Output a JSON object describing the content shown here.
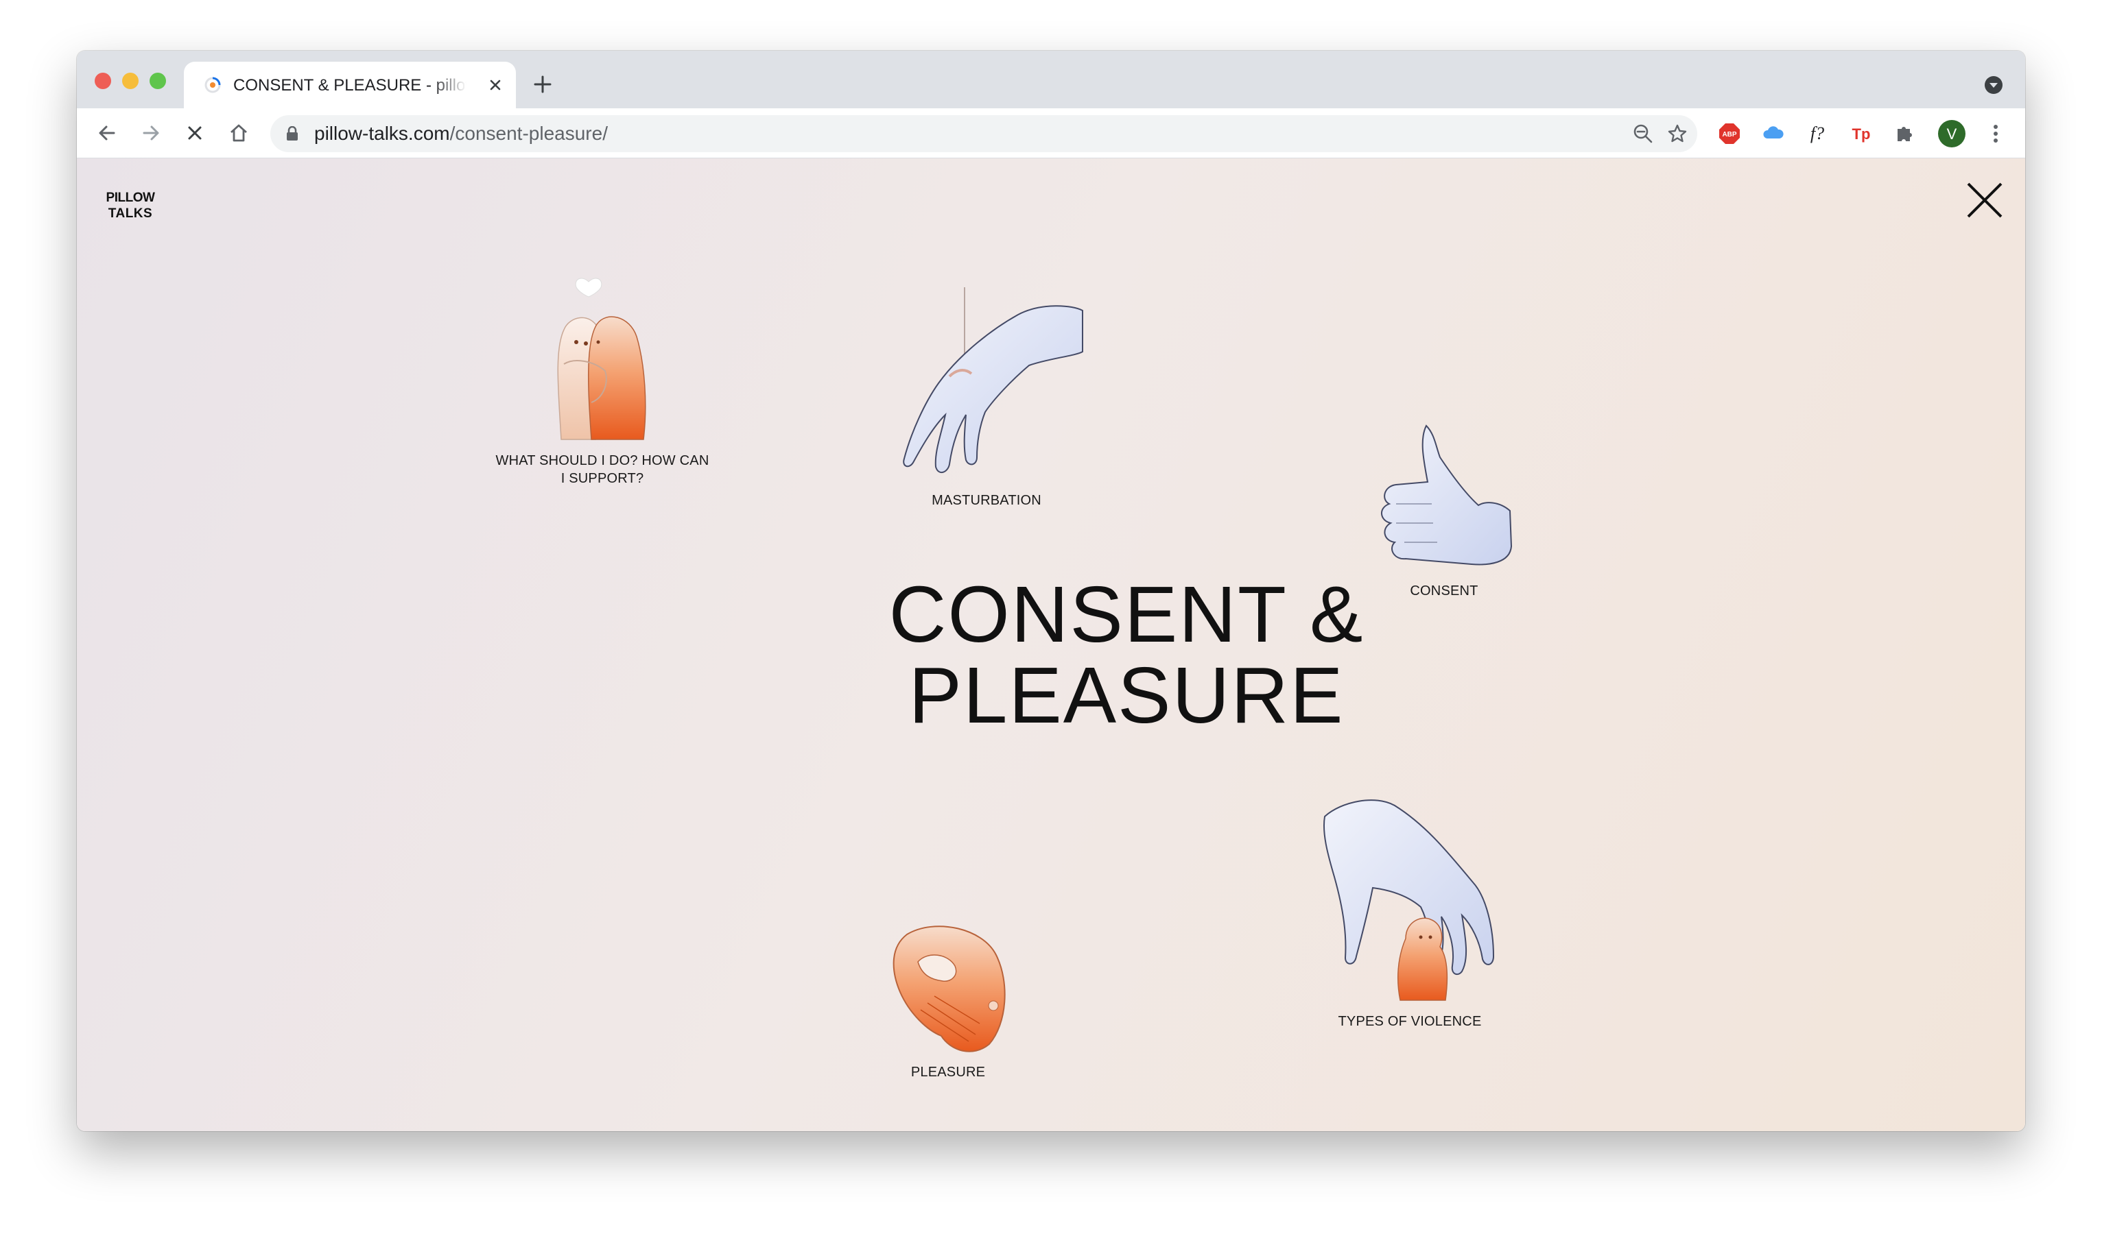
{
  "browser": {
    "tab_title": "CONSENT & PLEASURE - pillow-talks",
    "url_host": "pillow-talks.com",
    "url_path": "/consent-pleasure/",
    "profile_initial": "V",
    "ext_abp": "ABP",
    "ext_font": "f?",
    "ext_tp": "Tp"
  },
  "site": {
    "logo_line1": "PILLOW",
    "logo_line2": "TALKS",
    "heading_line1": "CONSENT &",
    "heading_line2": "PLEASURE"
  },
  "topics": [
    {
      "label": "WHAT SHOULD I DO? HOW CAN I SUPPORT?",
      "icon": "hugging-figures-icon"
    },
    {
      "label": "MASTURBATION",
      "icon": "hand-icon"
    },
    {
      "label": "CONSENT",
      "icon": "thumbs-up-icon"
    },
    {
      "label": "TYPES OF VIOLENCE",
      "icon": "grabbing-hand-icon"
    },
    {
      "label": "PLEASURE",
      "icon": "toy-icon"
    }
  ],
  "colors": {
    "accent_orange": "#ee6a2c",
    "glove_blue": "#dfe4f5",
    "bg_pink": "#ede5e6"
  }
}
